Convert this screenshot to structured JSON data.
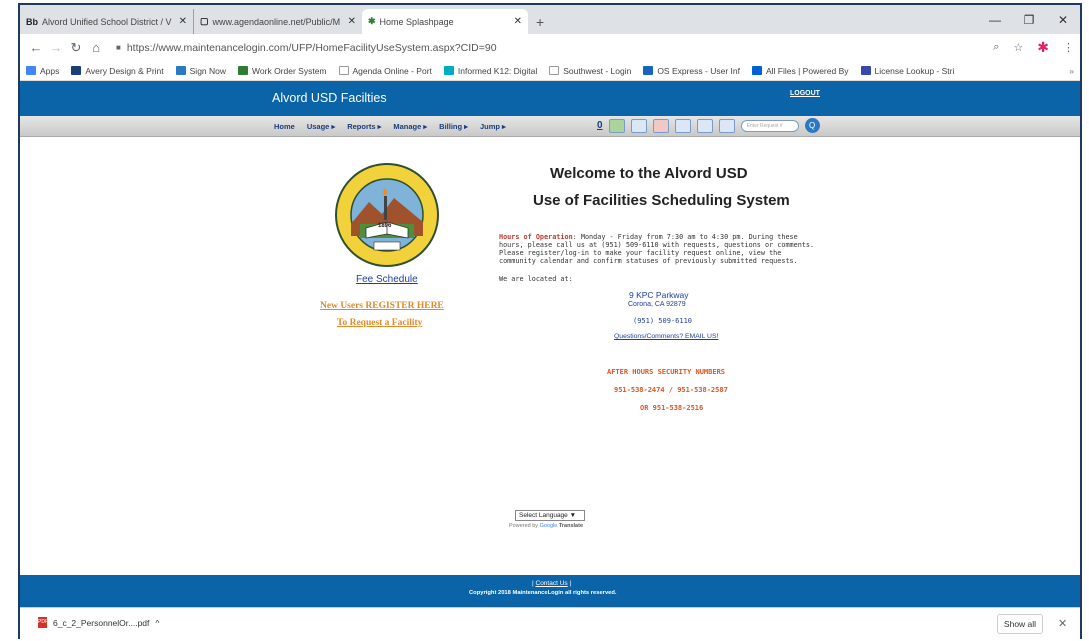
{
  "browser": {
    "tabs": [
      {
        "icon": "Bb",
        "title": "Alvord Unified School District / V"
      },
      {
        "icon": "",
        "title": "www.agendaonline.net/Public/M"
      },
      {
        "icon": "",
        "title": "Home Splashpage"
      }
    ],
    "new_tab": "+",
    "url": "https://www.maintenancelogin.com/UFP/HomeFacilityUseSystem.aspx?CID=90",
    "bookmarks": [
      {
        "label": "Apps",
        "color": "#4285f4"
      },
      {
        "label": "Avery Design & Print",
        "color": "#1a3d7c"
      },
      {
        "label": "Sign Now",
        "color": "#2b78c5"
      },
      {
        "label": "Work Order System",
        "color": "#2e7d32"
      },
      {
        "label": "Agenda Online - Port",
        "color": "#999999"
      },
      {
        "label": "Informed K12: Digital",
        "color": "#00acc1"
      },
      {
        "label": "Southwest - Login",
        "color": "#999999"
      },
      {
        "label": "OS Express - User Inf",
        "color": "#1565c0"
      },
      {
        "label": "All Files | Powered By",
        "color": "#0061d5"
      },
      {
        "label": "License Lookup - Stri",
        "color": "#3949ab"
      }
    ],
    "bookmarks_more": "»"
  },
  "site": {
    "title": "Alvord USD Facilties",
    "logout": "LOGOUT",
    "menu": [
      "Home",
      "Usage ▸",
      "Reports ▸",
      "Manage ▸",
      "Billing ▸",
      "Jump ▸"
    ],
    "zero": "0",
    "request_placeholder": "Enter Request #",
    "go": "Q"
  },
  "logo": {
    "ring_text": "ALVORD UNIFIED SCHOOL DISTRICT",
    "year": "1896"
  },
  "left_links": {
    "fee_schedule": "Fee Schedule",
    "new_users": "New Users REGISTER HERE",
    "request_facility": "To Request a Facility"
  },
  "main": {
    "heading1": "Welcome to the Alvord USD",
    "heading2": "Use of Facilities Scheduling System",
    "hours_label": "Hours of Operation",
    "hours_text": ": Monday - Friday from 7:30 am to 4:30 pm.  During these hours, please call us at (951) 509-6110 with requests, questions or comments.  Please register/log-in to make your facility request online, view the community calendar and confirm statuses of previously submitted requests.",
    "located": "We are located at:",
    "address1": "9 KPC Parkway",
    "address2": "Corona, CA 92879",
    "phone": "(951) 509-6110",
    "email": "Questions/Comments? EMAIL US!",
    "security_title": "AFTER HOURS SECURITY NUMBERS",
    "security_line1": "951-538-2474 / 951-538-2587",
    "security_line2": "OR 951-538-2516"
  },
  "translate": {
    "select": "Select Language ▼",
    "powered_prefix": "Powered by ",
    "google": "Google",
    "translate": " Translate"
  },
  "footer": {
    "contact": "Contact Us",
    "copyright": "Copyright 2018 MaintenanceLogin all rights reserved."
  },
  "downloads": {
    "file": "6_c_2_PersonnelOr....pdf",
    "chevron": "^",
    "show_all": "Show all",
    "close": "✕"
  }
}
